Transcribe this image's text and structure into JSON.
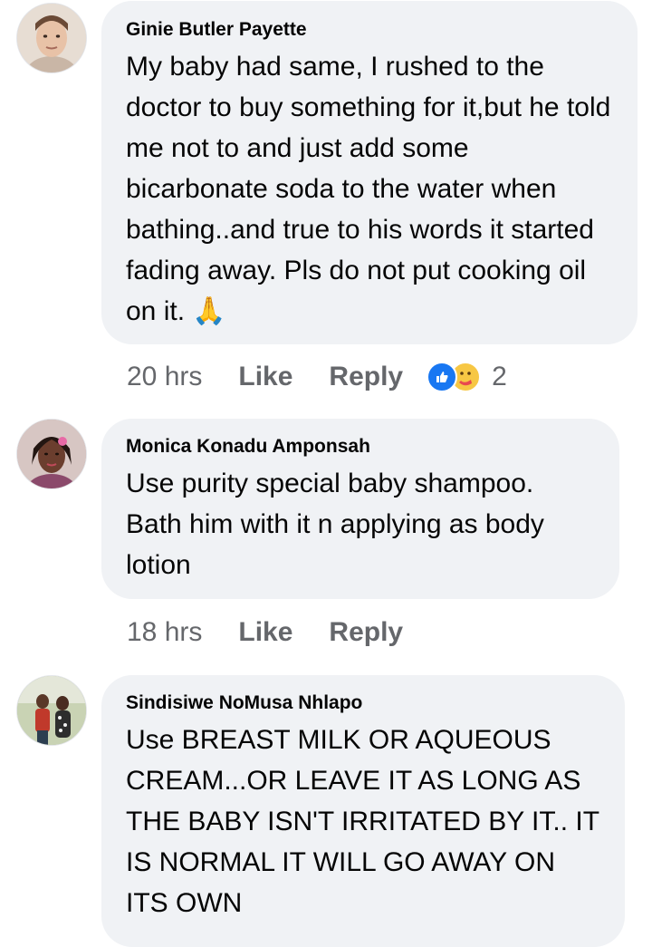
{
  "comments": [
    {
      "author": "Ginie Butler Payette",
      "text": "My baby had same, I rushed to the doctor to buy something for it,but he told me not to and just add some bicarbonate soda to the water when bathing..and true to his words it started fading away. Pls do not put cooking oil on it. 🙏",
      "time": "20 hrs",
      "like_label": "Like",
      "reply_label": "Reply",
      "reaction_count": "2",
      "reactions": [
        "like-icon",
        "care-icon"
      ]
    },
    {
      "author": "Monica Konadu Amponsah",
      "text": "Use purity special baby shampoo. Bath him with it n applying as body lotion",
      "time": "18 hrs",
      "like_label": "Like",
      "reply_label": "Reply"
    },
    {
      "author": "Sindisiwe NoMusa Nhlapo",
      "text": "Use BREAST MILK OR AQUEOUS CREAM...OR LEAVE IT AS LONG AS THE BABY ISN'T IRRITATED BY IT.. IT IS NORMAL IT WILL GO AWAY ON ITS OWN"
    }
  ],
  "colors": {
    "bubble": "#f0f2f5",
    "meta": "#65676b",
    "like_blue": "#1877f2"
  }
}
